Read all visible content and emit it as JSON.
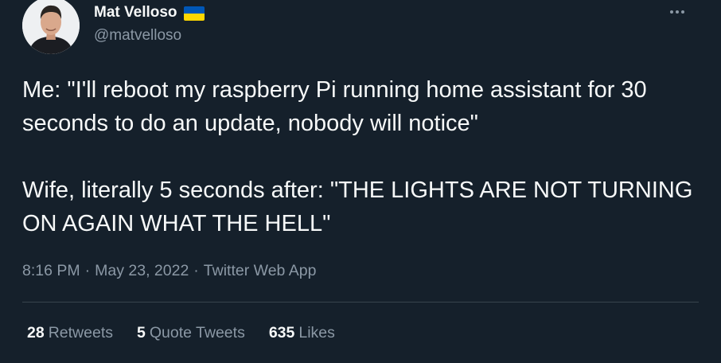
{
  "author": {
    "name": "Mat Velloso",
    "handle": "@matvelloso",
    "badge": "ukraine-flag",
    "flag_colors": [
      "#0057b7",
      "#ffd700"
    ]
  },
  "tweet": {
    "paragraphs": [
      "Me: \"I'll reboot my raspberry Pi running home assistant for 30 seconds to do an update, nobody will notice\"",
      "Wife, literally 5 seconds after: \"THE LIGHTS ARE NOT TURNING ON AGAIN WHAT THE HELL\""
    ]
  },
  "meta": {
    "time": "8:16 PM",
    "date": "May 23, 2022",
    "source": "Twitter Web App",
    "separator": "·"
  },
  "stats": {
    "retweets_count": "28",
    "retweets_label": "Retweets",
    "quotes_count": "5",
    "quotes_label": "Quote Tweets",
    "likes_count": "635",
    "likes_label": "Likes"
  },
  "icons": {
    "more": "more-horizontal-icon"
  },
  "colors": {
    "background": "#15202b",
    "text_primary": "#f7f9f9",
    "text_secondary": "#8b98a5",
    "divider": "#38444d"
  }
}
